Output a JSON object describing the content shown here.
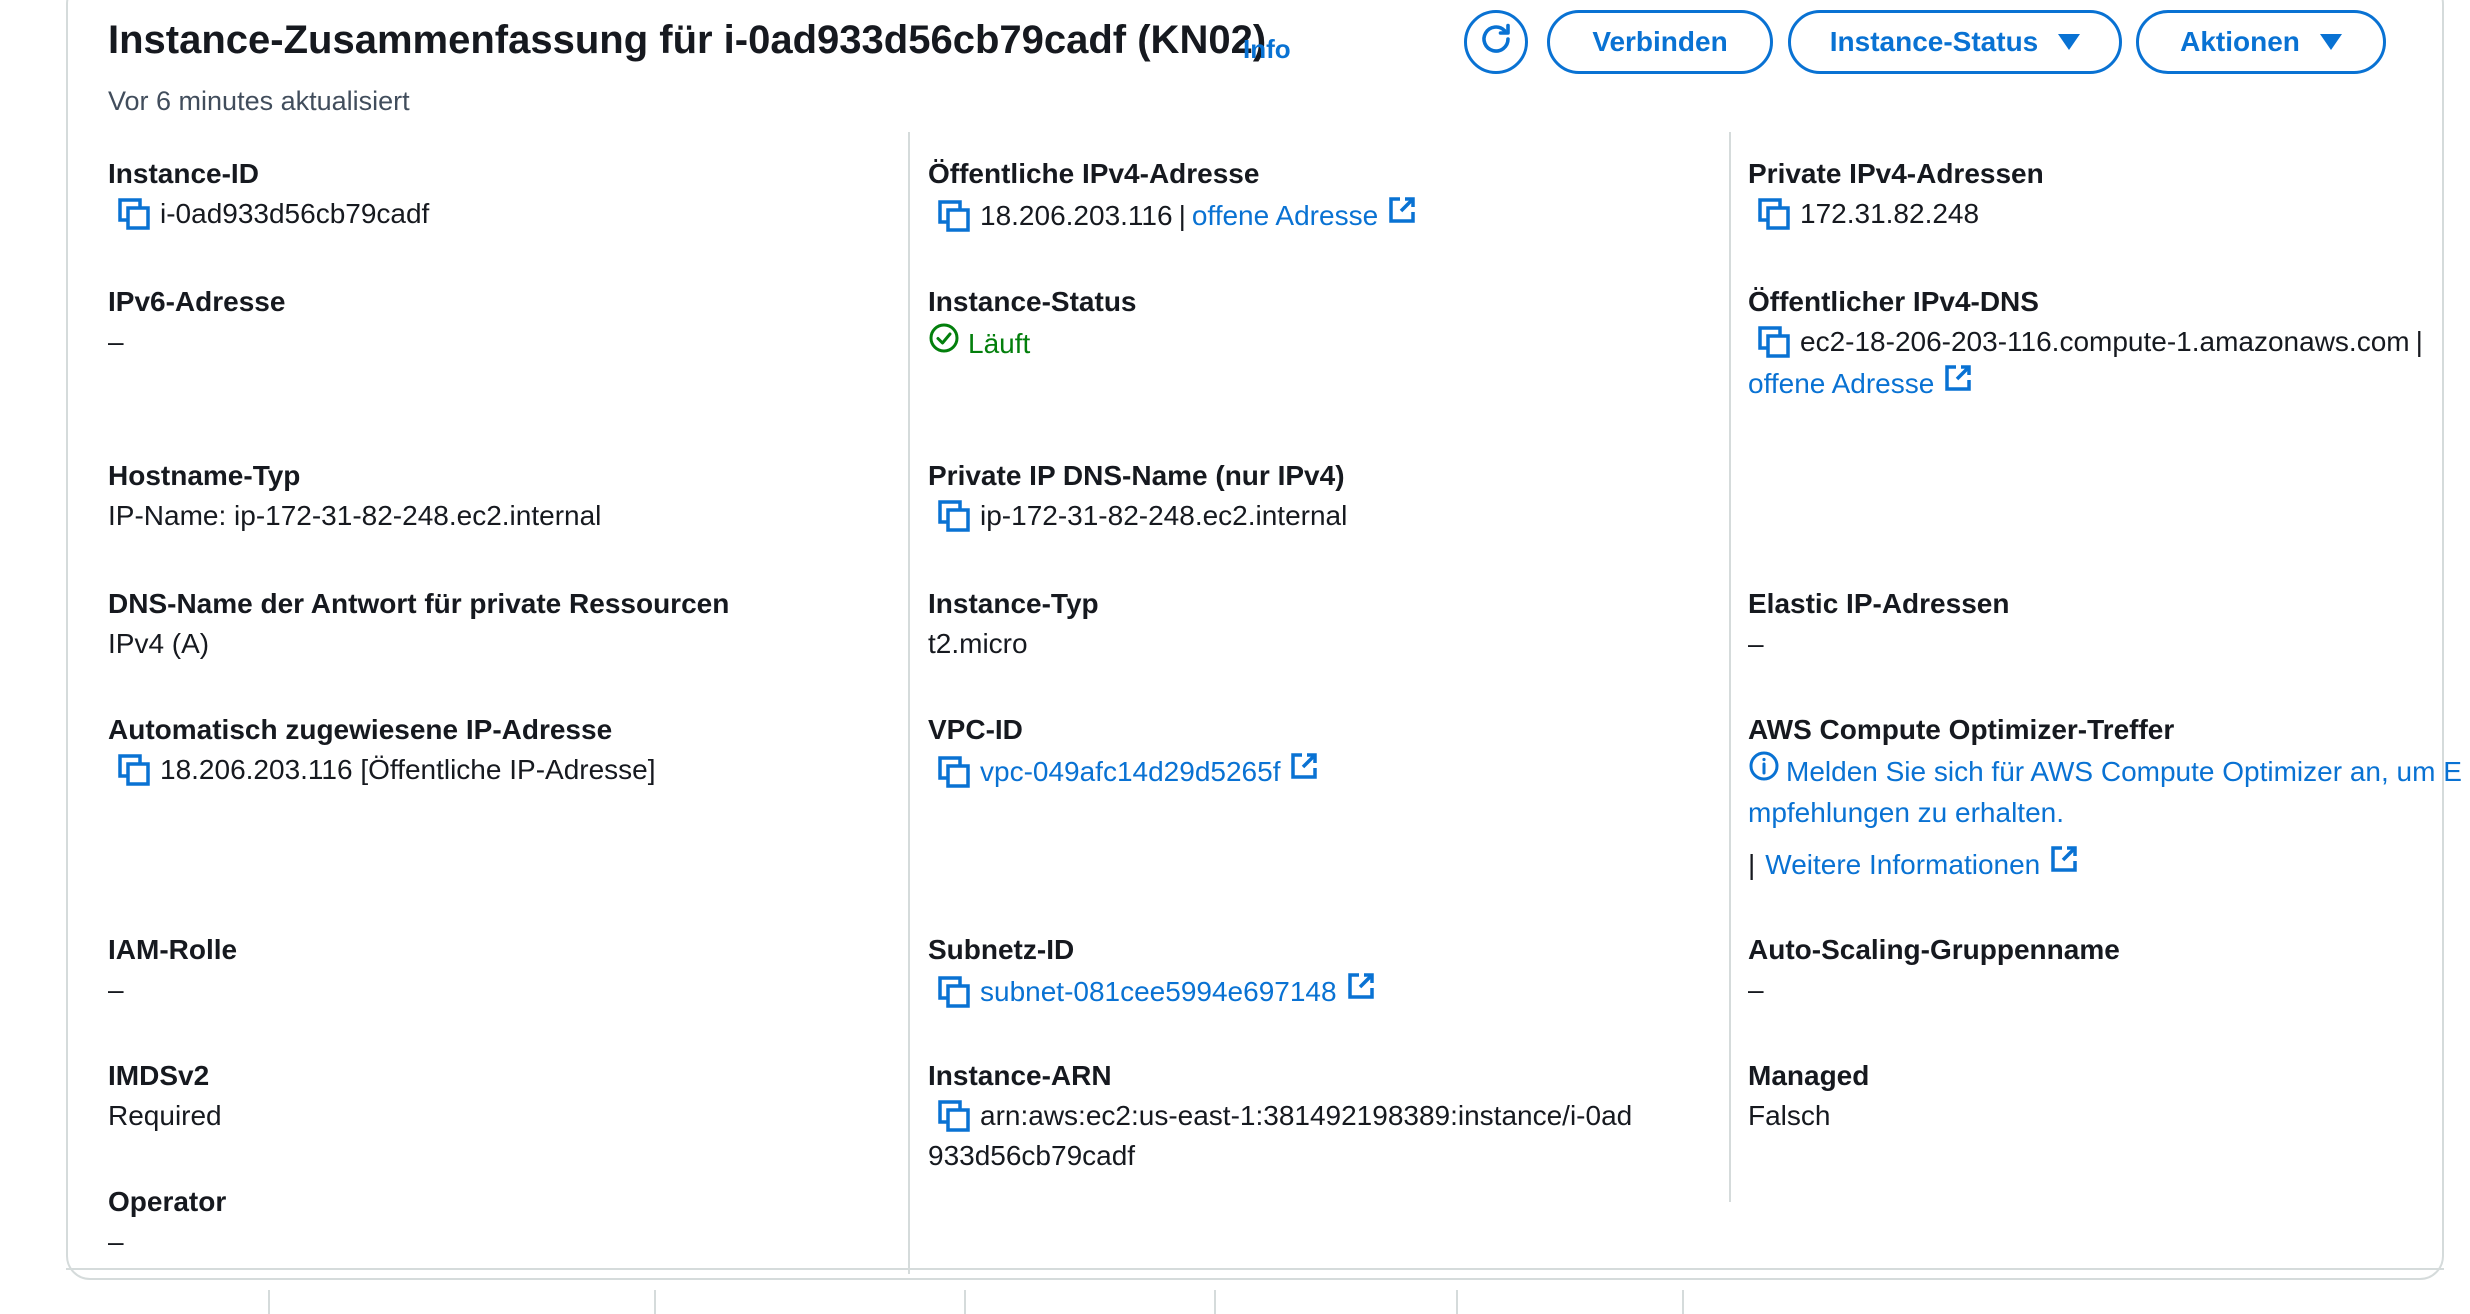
{
  "header": {
    "title": "Instance-Zusammenfassung für i-0ad933d56cb79cadf (KN02)",
    "info": "Info",
    "updated": "Vor 6 minutes aktualisiert",
    "buttons": {
      "connect": "Verbinden",
      "status": "Instance-Status",
      "actions": "Aktionen"
    }
  },
  "col1": {
    "instance_id": {
      "label": "Instance-ID",
      "value": "i-0ad933d56cb79cadf"
    },
    "ipv6": {
      "label": "IPv6-Adresse",
      "value": "–"
    },
    "hostname_type": {
      "label": "Hostname-Typ",
      "value": "IP-Name: ip-172-31-82-248.ec2.internal"
    },
    "dns_answer": {
      "label": "DNS-Name der Antwort für private Ressourcen",
      "value": "IPv4 (A)"
    },
    "auto_ip": {
      "label": "Automatisch zugewiesene IP-Adresse",
      "value": "18.206.203.116 [Öffentliche IP-Adresse]"
    },
    "iam": {
      "label": "IAM-Rolle",
      "value": "–"
    },
    "imds": {
      "label": "IMDSv2",
      "value": "Required"
    },
    "operator": {
      "label": "Operator",
      "value": "–"
    }
  },
  "col2": {
    "public_ipv4": {
      "label": "Öffentliche IPv4-Adresse",
      "value": "18.206.203.116",
      "sep": "|",
      "link": "offene Adresse"
    },
    "instance_state": {
      "label": "Instance-Status",
      "value": "Läuft"
    },
    "private_dns": {
      "label": "Private IP DNS-Name (nur IPv4)",
      "value": "ip-172-31-82-248.ec2.internal"
    },
    "instance_type": {
      "label": "Instance-Typ",
      "value": "t2.micro"
    },
    "vpc": {
      "label": "VPC-ID",
      "value": "vpc-049afc14d29d5265f"
    },
    "subnet": {
      "label": "Subnetz-ID",
      "value": "subnet-081cee5994e697148"
    },
    "arn": {
      "label": "Instance-ARN",
      "value_line1": "arn:aws:ec2:us-east-1:381492198389:instance/i-0ad",
      "value_line2": "933d56cb79cadf"
    }
  },
  "col3": {
    "private_ipv4": {
      "label": "Private IPv4-Adressen",
      "value": "172.31.82.248"
    },
    "public_dns": {
      "label": "Öffentlicher IPv4-DNS",
      "value": "ec2-18-206-203-116.compute-1.amazonaws.com",
      "sep": "|",
      "link": "offene Adresse"
    },
    "elastic": {
      "label": "Elastic IP-Adressen",
      "value": "–"
    },
    "optimizer": {
      "label": "AWS Compute Optimizer-Treffer",
      "line1": "Melden Sie sich für AWS Compute Optimizer an, um E",
      "line2": "mpfehlungen zu erhalten.",
      "sep": "|",
      "more": "Weitere Informationen"
    },
    "asg": {
      "label": "Auto-Scaling-Gruppenname",
      "value": "–"
    },
    "managed": {
      "label": "Managed",
      "value": "Falsch"
    }
  },
  "colors": {
    "link": "#0972d3",
    "success": "#037f0c",
    "text": "#16191f",
    "border": "#d5dbdb"
  },
  "icons": [
    "refresh-icon",
    "copy-icon",
    "external-link-icon",
    "status-ok-icon",
    "info-circle-icon",
    "caret-down-icon"
  ]
}
